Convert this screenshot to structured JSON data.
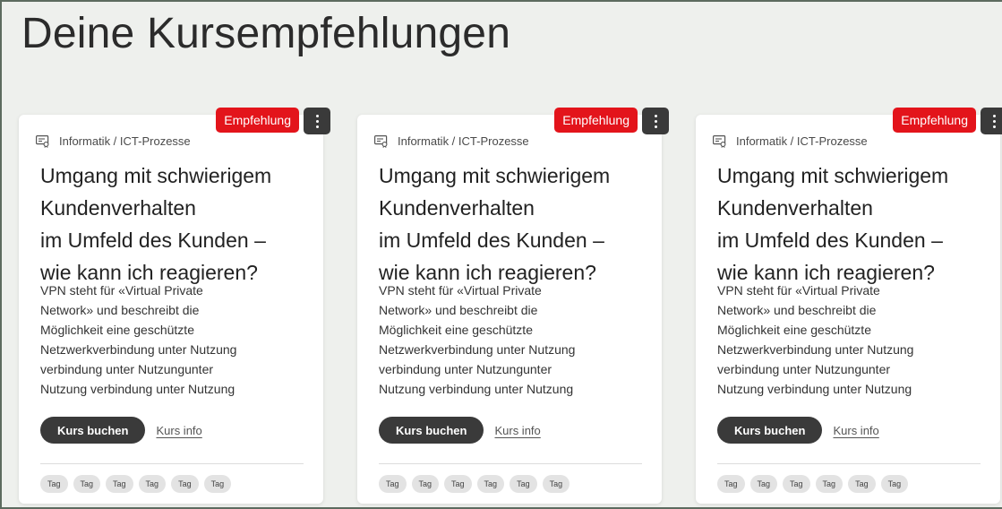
{
  "page": {
    "title": "Deine Kursempfehlungen"
  },
  "colors": {
    "accent": "#e3141b",
    "dark": "#3a3a3a",
    "background": "#eef0ed"
  },
  "icons": {
    "category": "course-category-icon",
    "menu": "more-vertical-icon"
  },
  "cards": [
    {
      "badge": "Empfehlung",
      "category": "Informatik / ICT-Prozesse",
      "title_lines": [
        "Umgang mit schwierigem",
        "Kundenverhalten",
        "im Umfeld des Kunden –",
        "wie kann ich reagieren?"
      ],
      "description_lines": [
        "VPN steht für «Virtual Private",
        "Network» und beschreibt die",
        "Möglichkeit eine geschützte",
        "Netzwerkverbindung unter Nutzung",
        "verbindung unter Nutzungunter",
        "Nutzung verbindung unter Nutzung"
      ],
      "book_label": "Kurs buchen",
      "info_label": "Kurs info",
      "tags": [
        "Tag",
        "Tag",
        "Tag",
        "Tag",
        "Tag",
        "Tag"
      ]
    },
    {
      "badge": "Empfehlung",
      "category": "Informatik / ICT-Prozesse",
      "title_lines": [
        "Umgang mit schwierigem",
        "Kundenverhalten",
        "im Umfeld des Kunden –",
        "wie kann ich reagieren?"
      ],
      "description_lines": [
        "VPN steht für «Virtual Private",
        "Network» und beschreibt die",
        "Möglichkeit eine geschützte",
        "Netzwerkverbindung unter Nutzung",
        "verbindung unter Nutzungunter",
        "Nutzung verbindung unter Nutzung"
      ],
      "book_label": "Kurs buchen",
      "info_label": "Kurs info",
      "tags": [
        "Tag",
        "Tag",
        "Tag",
        "Tag",
        "Tag",
        "Tag"
      ]
    },
    {
      "badge": "Empfehlung",
      "category": "Informatik / ICT-Prozesse",
      "title_lines": [
        "Umgang mit schwierigem",
        "Kundenverhalten",
        "im Umfeld des Kunden –",
        "wie kann ich reagieren?"
      ],
      "description_lines": [
        "VPN steht für «Virtual Private",
        "Network» und beschreibt die",
        "Möglichkeit eine geschützte",
        "Netzwerkverbindung unter Nutzung",
        "verbindung unter Nutzungunter",
        "Nutzung verbindung unter Nutzung"
      ],
      "book_label": "Kurs buchen",
      "info_label": "Kurs info",
      "tags": [
        "Tag",
        "Tag",
        "Tag",
        "Tag",
        "Tag",
        "Tag"
      ]
    }
  ]
}
